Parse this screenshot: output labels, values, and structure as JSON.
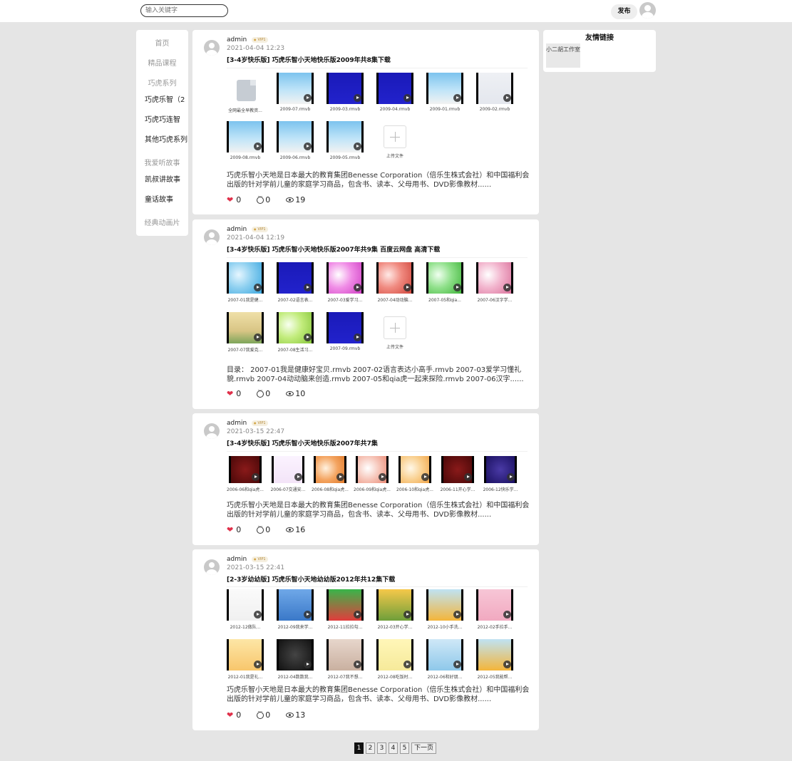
{
  "header": {
    "search_placeholder": "输入关键字",
    "publish_label": "发布"
  },
  "sidebar": {
    "items": [
      {
        "label": "首页",
        "style": "muted"
      },
      {
        "label": "精品课程",
        "style": "muted"
      },
      {
        "label": "巧虎系列",
        "style": "muted"
      },
      {
        "label": "巧虎乐智（2",
        "style": "dark"
      },
      {
        "label": "巧虎巧连智",
        "style": "dark"
      },
      {
        "label": "其他巧虎系列",
        "style": "dark"
      },
      {
        "label": "我爱听故事",
        "style": "muted"
      },
      {
        "label": "凯叔讲故事",
        "style": "dark"
      },
      {
        "label": "童话故事",
        "style": "dark"
      },
      {
        "label": "经典动画片",
        "style": "muted"
      }
    ]
  },
  "links": {
    "title": "友情链接",
    "items": [
      "小二胡工作室"
    ]
  },
  "posts": [
    {
      "author": "admin",
      "vip": "VIP1",
      "date": "2021-04-04 12:23",
      "title": "[3-4岁快乐版] 巧虎乐智小天地快乐版2009年共8集下载",
      "files": [
        {
          "name": "全网最全早教资...",
          "kind": "doc"
        },
        {
          "name": "2009-07.rmvb",
          "kind": "video",
          "style": "sky"
        },
        {
          "name": "2009-03.rmvb",
          "kind": "video",
          "style": "blue"
        },
        {
          "name": "2009-04.rmvb",
          "kind": "video",
          "style": "blue"
        },
        {
          "name": "2009-01.rmvb",
          "kind": "video",
          "style": "sky"
        },
        {
          "name": "2009-02.rmvb",
          "kind": "video",
          "style": "pale"
        },
        {
          "name": "2009-08.rmvb",
          "kind": "video",
          "style": "sky"
        },
        {
          "name": "2009-06.rmvb",
          "kind": "video",
          "style": "sky"
        },
        {
          "name": "2009-05.rmvb",
          "kind": "video",
          "style": "sky"
        }
      ],
      "upload_label": "上传文件",
      "description": "巧虎乐智小天地是日本最大的教育集团Benesse Corporation（倍乐生株式会社）和中国福利会出版的针对学前儿童的家庭学习商品，包含书、读本、父母用书、DVD影像教材......",
      "likes": "0",
      "comments": "0",
      "views": "19"
    },
    {
      "author": "admin",
      "vip": "VIP1",
      "date": "2021-04-04 12:19",
      "title": "[3-4岁快乐版] 巧虎乐智小天地快乐版2007年共9集 百度云网盘 高清下载",
      "files": [
        {
          "name": "2007-01我是健...",
          "kind": "video",
          "style": "bubble-blue"
        },
        {
          "name": "2007-02语言表...",
          "kind": "video",
          "style": "blue"
        },
        {
          "name": "2007-03爱学习...",
          "kind": "video",
          "style": "bubble-pink"
        },
        {
          "name": "2007-04动动脑...",
          "kind": "video",
          "style": "bubble-red"
        },
        {
          "name": "2007-05和qia...",
          "kind": "video",
          "style": "bubble-green"
        },
        {
          "name": "2007-06汉字学...",
          "kind": "video",
          "style": "bubble-rose"
        },
        {
          "name": "2007-07我爱克...",
          "kind": "video",
          "style": "scene"
        },
        {
          "name": "2007-08生活习...",
          "kind": "video",
          "style": "bubble-lime"
        },
        {
          "name": "2007-09.rmvb",
          "kind": "video",
          "style": "blue"
        }
      ],
      "upload_label": "上传文件",
      "description": "目录： 2007-01我是健康好宝贝.rmvb 2007-02语言表达小高手.rmvb 2007-03爱学习懂礼貌.rmvb 2007-04动动脑来创造.rmvb 2007-05和qia虎一起来探险.rmvb 2007-06汉字......",
      "likes": "0",
      "comments": "0",
      "views": "10"
    },
    {
      "author": "admin",
      "vip": "VIP1",
      "date": "2021-03-15 22:47",
      "title": "[3-4岁快乐版] 巧虎乐智小天地快乐版2007年共7集",
      "files": [
        {
          "name": "2006-06和qia虎...",
          "kind": "video",
          "style": "dark-red"
        },
        {
          "name": "2006-07交通安...",
          "kind": "video",
          "style": "lavender"
        },
        {
          "name": "2006-08和qia虎...",
          "kind": "video",
          "style": "orange"
        },
        {
          "name": "2006-09和qia虎...",
          "kind": "video",
          "style": "peach"
        },
        {
          "name": "2006-10和qia虎...",
          "kind": "video",
          "style": "light-orange"
        },
        {
          "name": "2006-11开心学...",
          "kind": "video",
          "style": "dark-red"
        },
        {
          "name": "2006-12快乐学...",
          "kind": "video",
          "style": "navy"
        }
      ],
      "upload_label": "",
      "description": "巧虎乐智小天地是日本最大的教育集团Benesse Corporation（倍乐生株式会社）和中国福利会出版的针对学前儿童的家庭学习商品，包含书、读本、父母用书、DVD影像教材......",
      "likes": "0",
      "comments": "0",
      "views": "16"
    },
    {
      "author": "admin",
      "vip": "VIP1",
      "date": "2021-03-15 22:41",
      "title": "[2-3岁幼幼版] 巧虎乐智小天地幼幼版2012年共12集下载",
      "files": [
        {
          "name": "2012-12做队...",
          "kind": "video",
          "style": "kids"
        },
        {
          "name": "2012-09我来学...",
          "kind": "video",
          "style": "toy-blue"
        },
        {
          "name": "2012-11拉拉勾...",
          "kind": "video",
          "style": "toy-green"
        },
        {
          "name": "2012-03开心学...",
          "kind": "video",
          "style": "toy-yellow"
        },
        {
          "name": "2012-10小手洗...",
          "kind": "video",
          "style": "tiger"
        },
        {
          "name": "2012-02手拉手...",
          "kind": "video",
          "style": "pink"
        },
        {
          "name": "2012-01我是礼...",
          "kind": "video",
          "style": "baby"
        },
        {
          "name": "2012-04数数我...",
          "kind": "video",
          "style": "pot"
        },
        {
          "name": "2012-07我不想...",
          "kind": "video",
          "style": "room"
        },
        {
          "name": "2012-08吃饭时...",
          "kind": "video",
          "style": "cream"
        },
        {
          "name": "2012-06和好朋...",
          "kind": "video",
          "style": "group"
        },
        {
          "name": "2012-05我能帮...",
          "kind": "video",
          "style": "tiger"
        }
      ],
      "upload_label": "",
      "description": "巧虎乐智小天地是日本最大的教育集团Benesse Corporation（倍乐生株式会社）和中国福利会出版的针对学前儿童的家庭学习商品，包含书、读本、父母用书、DVD影像教材......",
      "likes": "0",
      "comments": "0",
      "views": "13"
    }
  ],
  "pagination": {
    "pages": [
      "1",
      "2",
      "3",
      "4",
      "5"
    ],
    "active": "1",
    "next_label": "下一页"
  },
  "colors": {
    "background": "#e5e5e5",
    "heart": "#e0304a",
    "vip": "#b58a3a"
  }
}
